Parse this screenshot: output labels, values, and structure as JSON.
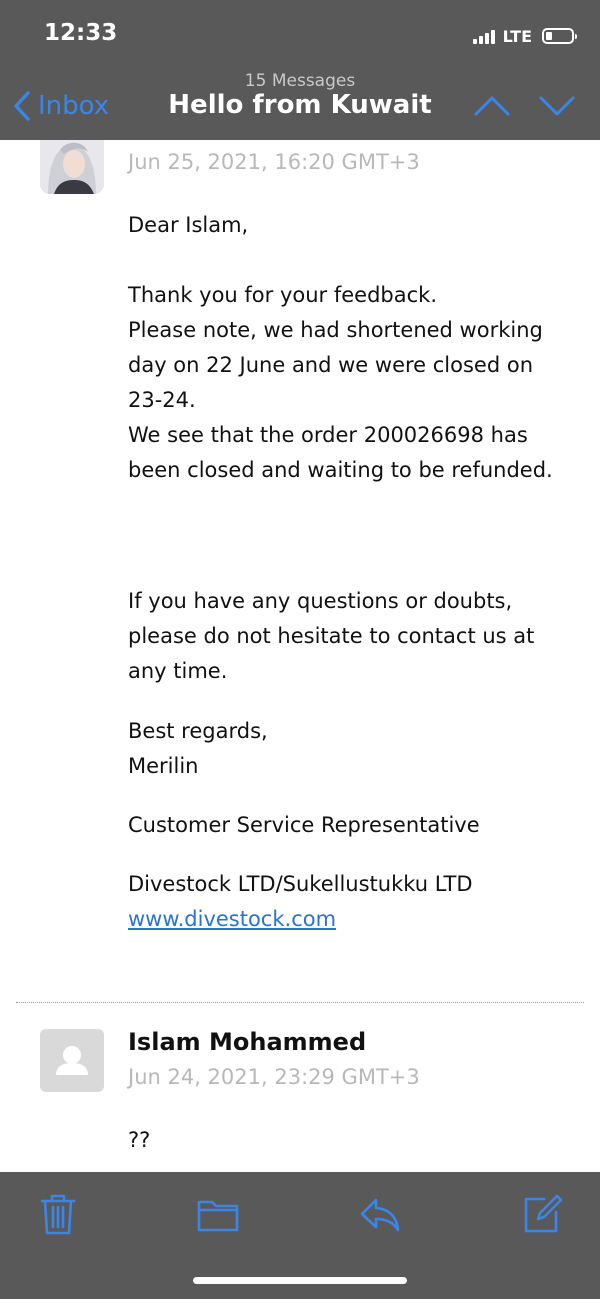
{
  "status_bar": {
    "time": "12:33",
    "network": "LTE"
  },
  "nav": {
    "back_label": "Inbox",
    "message_count": "15 Messages",
    "title": "Hello from Kuwait"
  },
  "message1": {
    "date": "Jun 25, 2021, 16:20 GMT+3",
    "greeting": "Dear Islam,",
    "body_lines": [
      "Thank you for your feedback.",
      "Please note, we had shortened working",
      "day on 22 June and we were closed on",
      "23-24.",
      "We see that the order 200026698 has",
      "been closed and waiting to be refunded."
    ],
    "questions_lines": [
      "If you have any questions or doubts,",
      "please do not hesitate to contact us at",
      "any time."
    ],
    "closing": "Best regards,",
    "signature_name": "Merilin",
    "signature_title": "Customer Service Representative",
    "company": "Divestock LTD/Sukellustukku LTD",
    "website": "www.divestock.com"
  },
  "message2": {
    "sender": "Islam Mohammed",
    "date": "Jun 24, 2021, 23:29 GMT+3",
    "body": "??"
  },
  "toolbar": {
    "icons": [
      "trash-icon",
      "folder-icon",
      "reply-icon",
      "compose-icon"
    ]
  },
  "colors": {
    "chrome_bg": "#595959",
    "accent": "#3a86e8",
    "link": "#2a72d6",
    "meta_gray": "#b8b8b8"
  }
}
